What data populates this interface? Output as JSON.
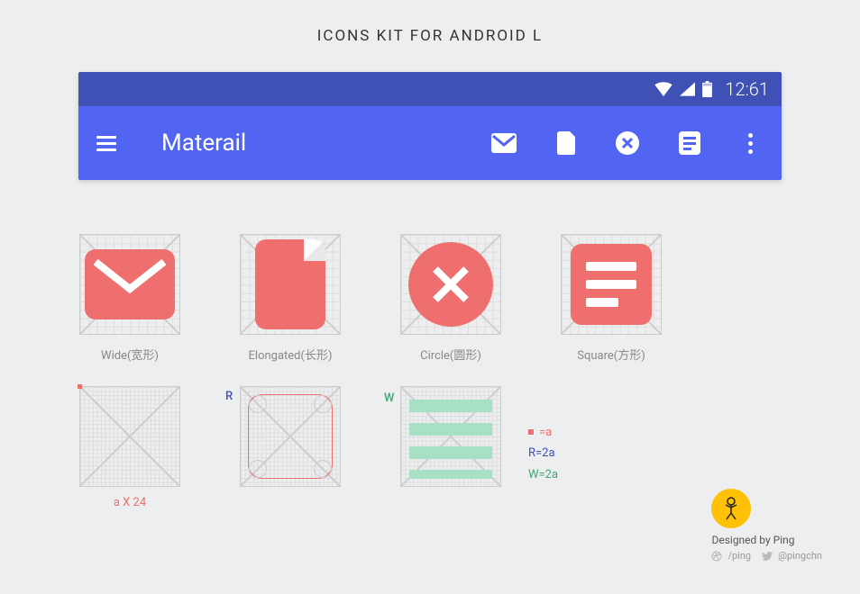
{
  "title": "ICONS KIT FOR ANDROID L",
  "status": {
    "time": "12:61"
  },
  "appbar": {
    "title": "Materail",
    "menu_icon": "hamburger",
    "action_icons": [
      "mail",
      "file",
      "close-circle",
      "list-document"
    ],
    "overflow": "dots-vertical"
  },
  "specimens": [
    {
      "shape": "wide",
      "label": "Wide(宽形)"
    },
    {
      "shape": "elongated",
      "label": "Elongated(长形)"
    },
    {
      "shape": "circle",
      "label": "Circle(圆形)"
    },
    {
      "shape": "square",
      "label": "Square(方形)"
    }
  ],
  "grids": {
    "a_label": "a X 24",
    "r_marker": "R",
    "w_marker": "W"
  },
  "legend": {
    "a": "=a",
    "r": "R=2a",
    "w": "W=2a"
  },
  "credit": {
    "by": "Designed by Ping",
    "dribbble": "/ping",
    "twitter": "@pingchn"
  },
  "colors": {
    "red": "#ef6f6f",
    "blue": "#3f51b5",
    "green": "#3fa86f",
    "appbar": "#5165f2"
  }
}
